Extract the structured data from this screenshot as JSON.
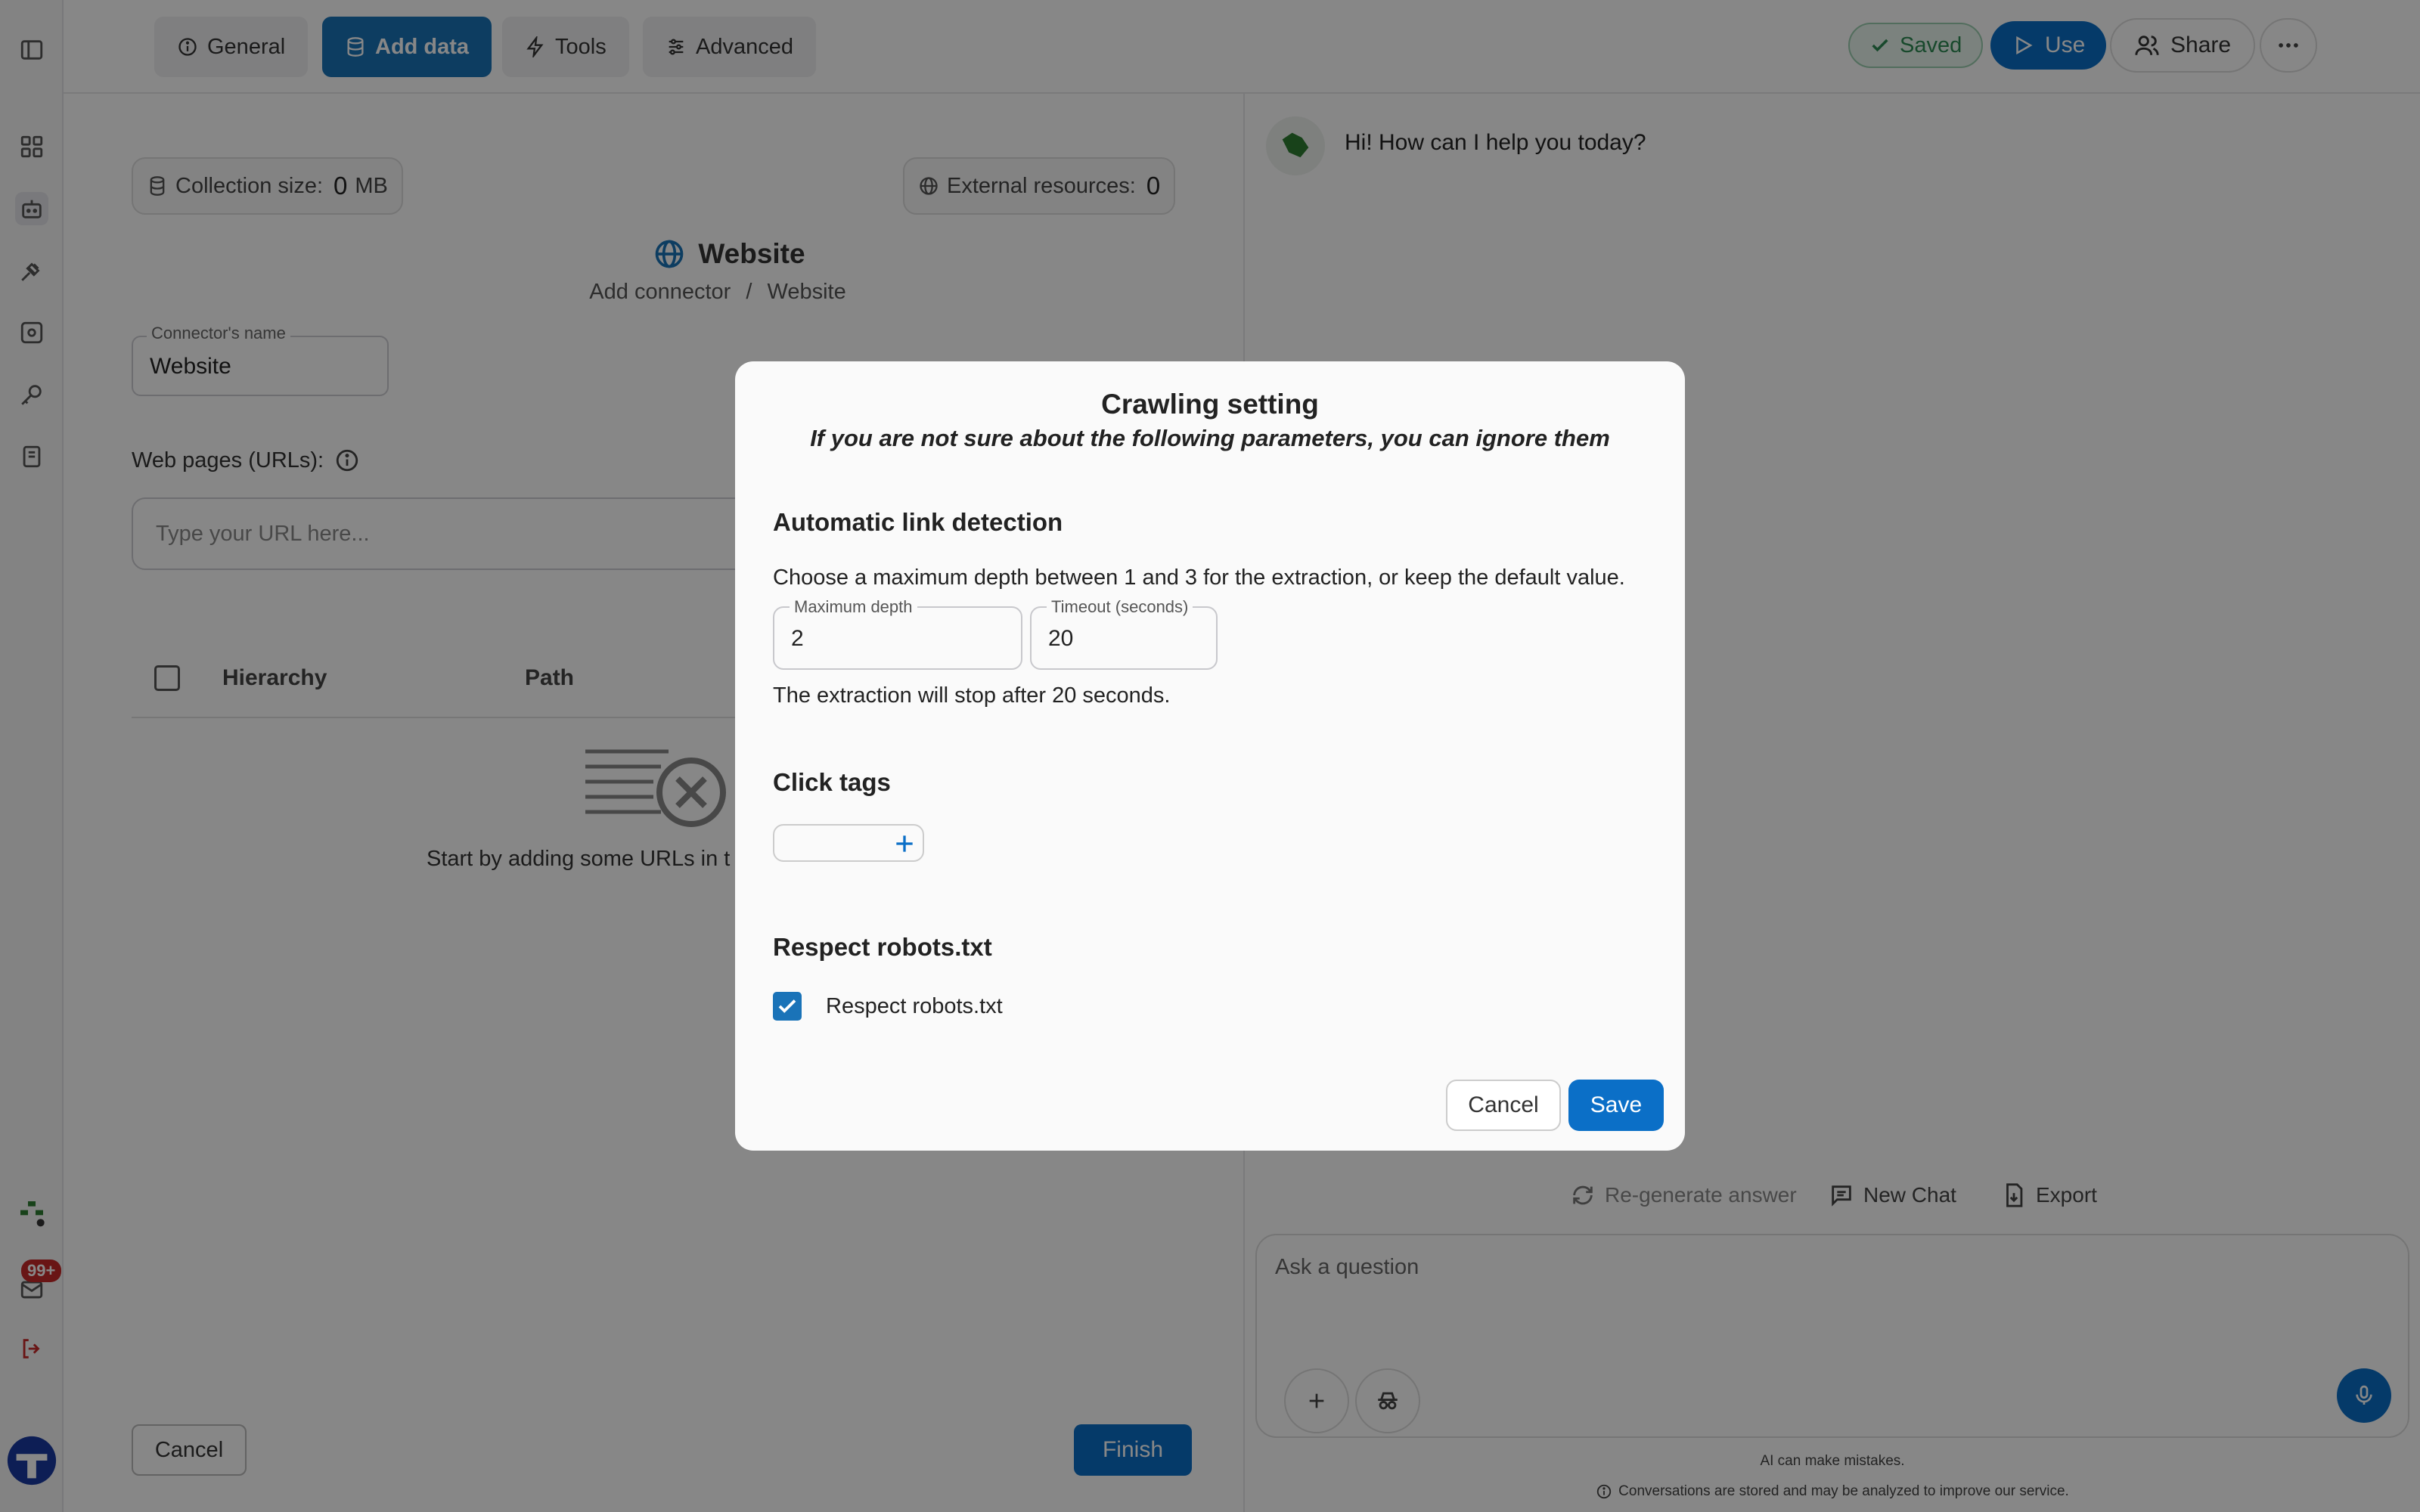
{
  "topbar": {
    "tabs": [
      {
        "label": "General",
        "icon": "info-icon"
      },
      {
        "label": "Add data",
        "icon": "database-icon",
        "active": true
      },
      {
        "label": "Tools",
        "icon": "bolt-icon"
      },
      {
        "label": "Advanced",
        "icon": "sliders-icon"
      }
    ],
    "saved_label": "Saved",
    "use_label": "Use",
    "share_label": "Share"
  },
  "rail": {
    "notification_badge": "99+"
  },
  "left": {
    "collection_size_label": "Collection size:",
    "collection_size_value": "0",
    "collection_size_unit": "MB",
    "external_resources_label": "External resources:",
    "external_resources_value": "0",
    "title": "Website",
    "breadcrumb": [
      "Add connector",
      "/",
      "Website"
    ],
    "connector_name_label": "Connector's name",
    "connector_name_value": "Website",
    "web_pages_label": "Web pages (URLs):",
    "url_placeholder": "Type your URL here...",
    "table_headers": [
      "Hierarchy",
      "Path"
    ],
    "empty_text": "Start by adding some URLs in t",
    "cancel_label": "Cancel",
    "finish_label": "Finish"
  },
  "chat": {
    "greeting": "Hi! How can I help you today?",
    "regenerate_label": "Re-generate answer",
    "new_chat_label": "New Chat",
    "export_label": "Export",
    "input_placeholder": "Ask a question",
    "footer_warning": "AI can make mistakes.",
    "footer_privacy": "Conversations are stored and may be analyzed to improve our service."
  },
  "modal": {
    "title": "Crawling setting",
    "subtitle": "If you are not sure about the following parameters, you can ignore them",
    "section_link_detection": "Automatic link detection",
    "link_detection_desc": "Choose a maximum depth between 1 and 3 for the extraction, or keep the default value.",
    "max_depth_label": "Maximum depth",
    "max_depth_value": "2",
    "timeout_label": "Timeout (seconds)",
    "timeout_value": "20",
    "timeout_desc": "The extraction will stop after 20 seconds.",
    "section_click_tags": "Click tags",
    "section_robots": "Respect robots.txt",
    "robots_checkbox_label": "Respect robots.txt",
    "robots_checked": true,
    "cancel_label": "Cancel",
    "save_label": "Save"
  },
  "colors": {
    "primary": "#0b6fc7",
    "saved_green": "#2e8a54",
    "badge_red": "#c62828",
    "overlay": "rgba(0,0,0,0.47)"
  }
}
